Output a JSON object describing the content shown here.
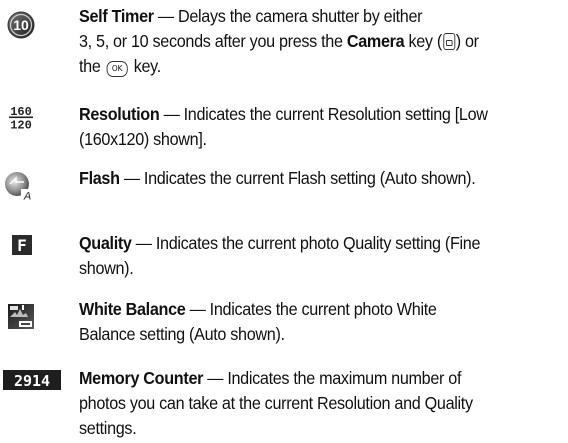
{
  "entries": [
    {
      "id": "self-timer",
      "icon": "self-timer-10-icon",
      "term": "Self Timer",
      "line1": "— Delays the camera shutter by either",
      "line2a": "3, 5, or 10 seconds after you press the ",
      "line2_key": "Camera",
      "line2b": " key (",
      "line2c": ") or",
      "line3a": "the ",
      "ok_key_label": "OK",
      "line3b": " key."
    },
    {
      "id": "resolution",
      "icon": "resolution-160x120-icon",
      "icon_text_top": "160",
      "icon_text_bottom": "120",
      "term": "Resolution",
      "line1": "— Indicates the current Resolution setting [Low",
      "line2": "(160x120) shown]."
    },
    {
      "id": "flash",
      "icon": "flash-auto-icon",
      "icon_text": "A",
      "term": "Flash",
      "line1": "— Indicates the current Flash setting (Auto shown)."
    },
    {
      "id": "quality",
      "icon": "quality-fine-icon",
      "icon_text": "F",
      "term": "Quality",
      "line1": "— Indicates the current photo Quality setting (Fine",
      "line2": "shown)."
    },
    {
      "id": "white-balance",
      "icon": "white-balance-auto-icon",
      "term": "White Balance",
      "line1": "— Indicates the current photo White",
      "line2": "Balance setting (Auto shown)."
    },
    {
      "id": "memory-counter",
      "icon": "memory-counter-icon",
      "icon_text": "2914",
      "term": "Memory Counter",
      "line1": "— Indicates the maximum number of",
      "line2": "photos you can take at the current Resolution and Quality",
      "line3": "settings."
    }
  ]
}
